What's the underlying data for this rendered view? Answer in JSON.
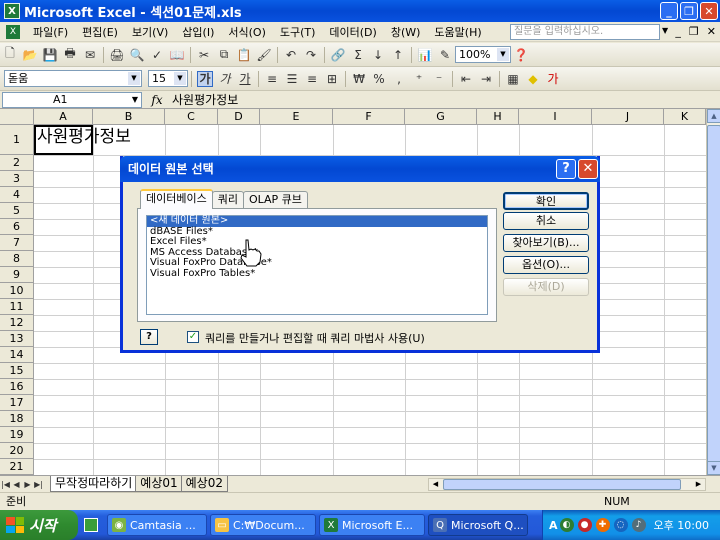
{
  "window": {
    "title": "Microsoft Excel - 섹션01문제.xls"
  },
  "menu": {
    "items": [
      "파일(F)",
      "편집(E)",
      "보기(V)",
      "삽입(I)",
      "서식(O)",
      "도구(T)",
      "데이터(D)",
      "창(W)",
      "도움말(H)"
    ],
    "ask_placeholder": "질문을 입력하십시오."
  },
  "toolbar": {
    "zoom": "100%",
    "font_name": "돋움",
    "font_size": "15",
    "bold_label": "가",
    "italic_label": "가",
    "underline_label": "가"
  },
  "formula_bar": {
    "name_box": "A1",
    "fx_label": "fx",
    "content": "사원평가정보"
  },
  "grid": {
    "columns": [
      "A",
      "B",
      "C",
      "D",
      "E",
      "F",
      "G",
      "H",
      "I",
      "J",
      "K"
    ],
    "rows": [
      "1",
      "2",
      "3",
      "4",
      "5",
      "6",
      "7",
      "8",
      "9",
      "10",
      "11",
      "12",
      "13",
      "14",
      "15",
      "16",
      "17",
      "18",
      "19",
      "20",
      "21"
    ],
    "cell_a1": "사원평가정보"
  },
  "sheet_tabs": [
    "무작정따라하기",
    "예상01",
    "예상02"
  ],
  "status": {
    "left": "준비",
    "num": "NUM"
  },
  "dialog": {
    "title": "데이터 원본 선택",
    "tabs": [
      "데이터베이스",
      "쿼리",
      "OLAP 큐브"
    ],
    "list_items": [
      "<새 데이터 원본>",
      "dBASE Files*",
      "Excel Files*",
      "MS Access Database*",
      "Visual FoxPro Database*",
      "Visual FoxPro Tables*"
    ],
    "buttons": {
      "ok": "확인",
      "cancel": "취소",
      "browse": "찾아보기(B)...",
      "options": "옵션(O)...",
      "delete": "삭제(D)"
    },
    "checkbox_label": "쿼리를 만들거나 편집할 때 쿼리 마법사 사용(U)",
    "help_label": "?"
  },
  "taskbar": {
    "start_label": "시작",
    "buttons": [
      "Camtasia ...",
      "C:₩Docum...",
      "Microsoft E...",
      "Microsoft Q..."
    ],
    "clock": "오후 10:00",
    "tray_lang": "A"
  }
}
